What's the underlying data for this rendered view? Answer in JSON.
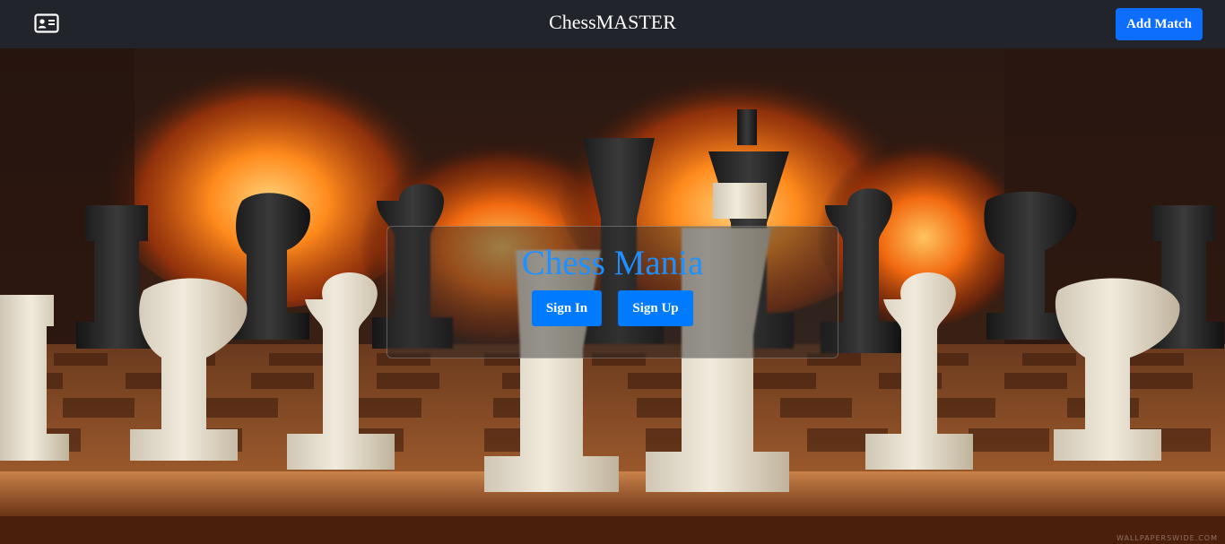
{
  "navbar": {
    "icon": "id-card-icon",
    "title": "ChessMASTER",
    "add_match_label": "Add Match"
  },
  "hero": {
    "background": "chess-pieces-fireplace-photo",
    "card": {
      "title": "Chess Mania",
      "sign_in_label": "Sign In",
      "sign_up_label": "Sign Up"
    },
    "watermark": "WALLPAPERSWIDE.COM"
  },
  "colors": {
    "navbar_bg": "#21252b",
    "primary_button": "#0d6efd",
    "card_title": "#1e90ff"
  }
}
